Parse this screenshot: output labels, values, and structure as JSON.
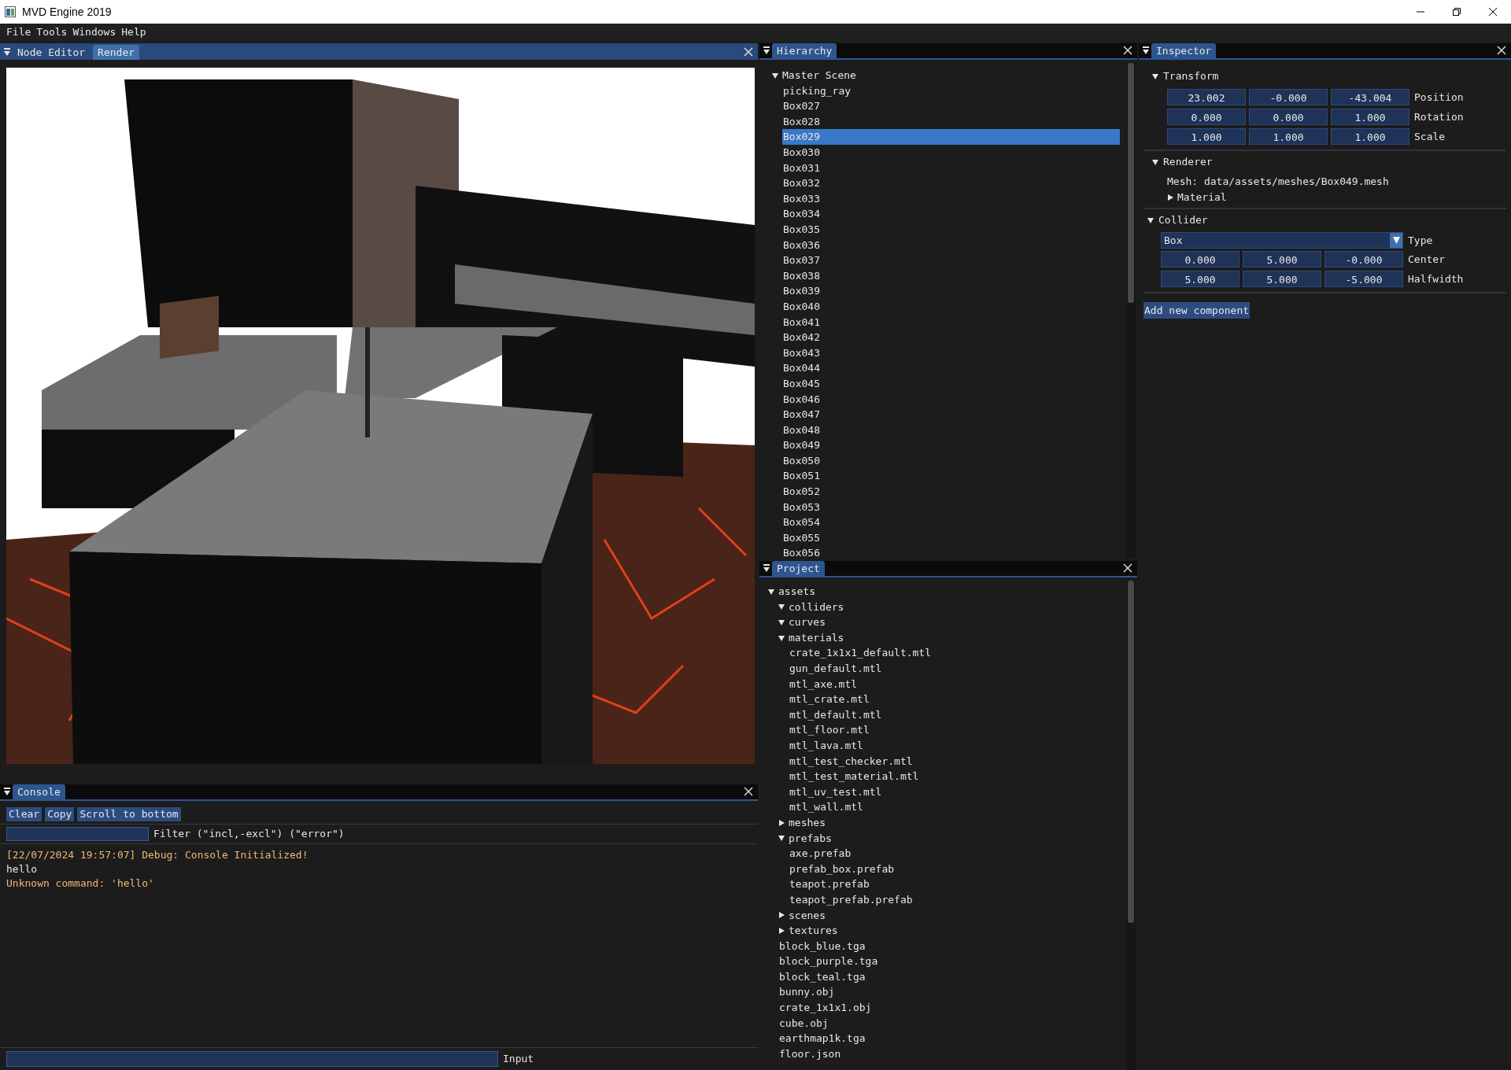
{
  "window": {
    "title": "MVD Engine 2019"
  },
  "menu": [
    "File",
    "Tools",
    "Windows",
    "Help"
  ],
  "render_panel": {
    "focused": true,
    "tabs": [
      {
        "label": "Node Editor",
        "selected": false
      },
      {
        "label": "Render",
        "selected": true
      }
    ]
  },
  "console": {
    "title": "Console",
    "focused": false,
    "buttons": [
      "Clear",
      "Copy",
      "Scroll to bottom"
    ],
    "filter_label": "Filter (\"incl,-excl\") (\"error\")",
    "lines": [
      {
        "kind": "log",
        "text": "[22/07/2024 19:57:07] Debug: Console Initialized!"
      },
      {
        "kind": "echo",
        "text": "hello"
      },
      {
        "kind": "log",
        "text": "Unknown command: 'hello'"
      }
    ],
    "input_label": "Input"
  },
  "hierarchy": {
    "title": "Hierarchy",
    "focused": false,
    "tree": [
      {
        "label": "Master Scene",
        "kind": "folder",
        "expanded": true,
        "selected": false,
        "children": [
          {
            "label": "picking_ray",
            "kind": "leaf",
            "selected": false
          },
          {
            "label": "Box027",
            "kind": "leaf",
            "selected": false
          },
          {
            "label": "Box028",
            "kind": "leaf",
            "selected": false
          },
          {
            "label": "Box029",
            "kind": "leaf",
            "selected": true
          },
          {
            "label": "Box030",
            "kind": "leaf",
            "selected": false
          },
          {
            "label": "Box031",
            "kind": "leaf",
            "selected": false
          },
          {
            "label": "Box032",
            "kind": "leaf",
            "selected": false
          },
          {
            "label": "Box033",
            "kind": "leaf",
            "selected": false
          },
          {
            "label": "Box034",
            "kind": "leaf",
            "selected": false
          },
          {
            "label": "Box035",
            "kind": "leaf",
            "selected": false
          },
          {
            "label": "Box036",
            "kind": "leaf",
            "selected": false
          },
          {
            "label": "Box037",
            "kind": "leaf",
            "selected": false
          },
          {
            "label": "Box038",
            "kind": "leaf",
            "selected": false
          },
          {
            "label": "Box039",
            "kind": "leaf",
            "selected": false
          },
          {
            "label": "Box040",
            "kind": "leaf",
            "selected": false
          },
          {
            "label": "Box041",
            "kind": "leaf",
            "selected": false
          },
          {
            "label": "Box042",
            "kind": "leaf",
            "selected": false
          },
          {
            "label": "Box043",
            "kind": "leaf",
            "selected": false
          },
          {
            "label": "Box044",
            "kind": "leaf",
            "selected": false
          },
          {
            "label": "Box045",
            "kind": "leaf",
            "selected": false
          },
          {
            "label": "Box046",
            "kind": "leaf",
            "selected": false
          },
          {
            "label": "Box047",
            "kind": "leaf",
            "selected": false
          },
          {
            "label": "Box048",
            "kind": "leaf",
            "selected": false
          },
          {
            "label": "Box049",
            "kind": "leaf",
            "selected": false
          },
          {
            "label": "Box050",
            "kind": "leaf",
            "selected": false
          },
          {
            "label": "Box051",
            "kind": "leaf",
            "selected": false
          },
          {
            "label": "Box052",
            "kind": "leaf",
            "selected": false
          },
          {
            "label": "Box053",
            "kind": "leaf",
            "selected": false
          },
          {
            "label": "Box054",
            "kind": "leaf",
            "selected": false
          },
          {
            "label": "Box055",
            "kind": "leaf",
            "selected": false
          },
          {
            "label": "Box056",
            "kind": "leaf",
            "selected": false
          }
        ]
      }
    ]
  },
  "project": {
    "title": "Project",
    "focused": false,
    "tree": [
      {
        "label": "assets",
        "kind": "folder",
        "expanded": true,
        "children": [
          {
            "label": "colliders",
            "kind": "folder",
            "expanded": true
          },
          {
            "label": "curves",
            "kind": "folder",
            "expanded": true
          },
          {
            "label": "materials",
            "kind": "folder",
            "expanded": true,
            "children": [
              {
                "label": "crate_1x1x1_default.mtl",
                "kind": "leaf"
              },
              {
                "label": "gun_default.mtl",
                "kind": "leaf"
              },
              {
                "label": "mtl_axe.mtl",
                "kind": "leaf"
              },
              {
                "label": "mtl_crate.mtl",
                "kind": "leaf"
              },
              {
                "label": "mtl_default.mtl",
                "kind": "leaf"
              },
              {
                "label": "mtl_floor.mtl",
                "kind": "leaf"
              },
              {
                "label": "mtl_lava.mtl",
                "kind": "leaf"
              },
              {
                "label": "mtl_test_checker.mtl",
                "kind": "leaf"
              },
              {
                "label": "mtl_test_material.mtl",
                "kind": "leaf"
              },
              {
                "label": "mtl_uv_test.mtl",
                "kind": "leaf"
              },
              {
                "label": "mtl_wall.mtl",
                "kind": "leaf"
              }
            ]
          },
          {
            "label": "meshes",
            "kind": "folder",
            "expanded": false
          },
          {
            "label": "prefabs",
            "kind": "folder",
            "expanded": true,
            "children": [
              {
                "label": "axe.prefab",
                "kind": "leaf"
              },
              {
                "label": "prefab_box.prefab",
                "kind": "leaf"
              },
              {
                "label": "teapot.prefab",
                "kind": "leaf"
              },
              {
                "label": "teapot_prefab.prefab",
                "kind": "leaf"
              }
            ]
          },
          {
            "label": "scenes",
            "kind": "folder",
            "expanded": false
          },
          {
            "label": "textures",
            "kind": "folder",
            "expanded": false
          },
          {
            "label": "block_blue.tga",
            "kind": "leaf"
          },
          {
            "label": "block_purple.tga",
            "kind": "leaf"
          },
          {
            "label": "block_teal.tga",
            "kind": "leaf"
          },
          {
            "label": "bunny.obj",
            "kind": "leaf"
          },
          {
            "label": "crate_1x1x1.obj",
            "kind": "leaf"
          },
          {
            "label": "cube.obj",
            "kind": "leaf"
          },
          {
            "label": "earthmap1k.tga",
            "kind": "leaf"
          },
          {
            "label": "floor.json",
            "kind": "leaf"
          }
        ]
      }
    ]
  },
  "inspector": {
    "title": "Inspector",
    "focused": false,
    "components": [
      {
        "kind": "transform",
        "title": "Transform",
        "expanded": true,
        "rows": [
          {
            "label": "Position",
            "values": [
              "23.002",
              "-0.000",
              "-43.004"
            ]
          },
          {
            "label": "Rotation",
            "values": [
              "0.000",
              "0.000",
              "1.000"
            ]
          },
          {
            "label": "Scale",
            "values": [
              "1.000",
              "1.000",
              "1.000"
            ]
          }
        ]
      },
      {
        "kind": "renderer",
        "title": "Renderer",
        "expanded": true,
        "mesh": "Mesh: data/assets/meshes/Box049.mesh",
        "material": {
          "label": "Material",
          "expanded": false
        }
      },
      {
        "kind": "collider",
        "title": "Collider",
        "expanded": true,
        "type": {
          "value": "Box",
          "label": "Type"
        },
        "rows": [
          {
            "label": "Center",
            "values": [
              "0.000",
              "5.000",
              "-0.000"
            ]
          },
          {
            "label": "Halfwidth",
            "values": [
              "5.000",
              "5.000",
              "-5.000"
            ]
          }
        ]
      }
    ],
    "add_button": "Add new component"
  }
}
